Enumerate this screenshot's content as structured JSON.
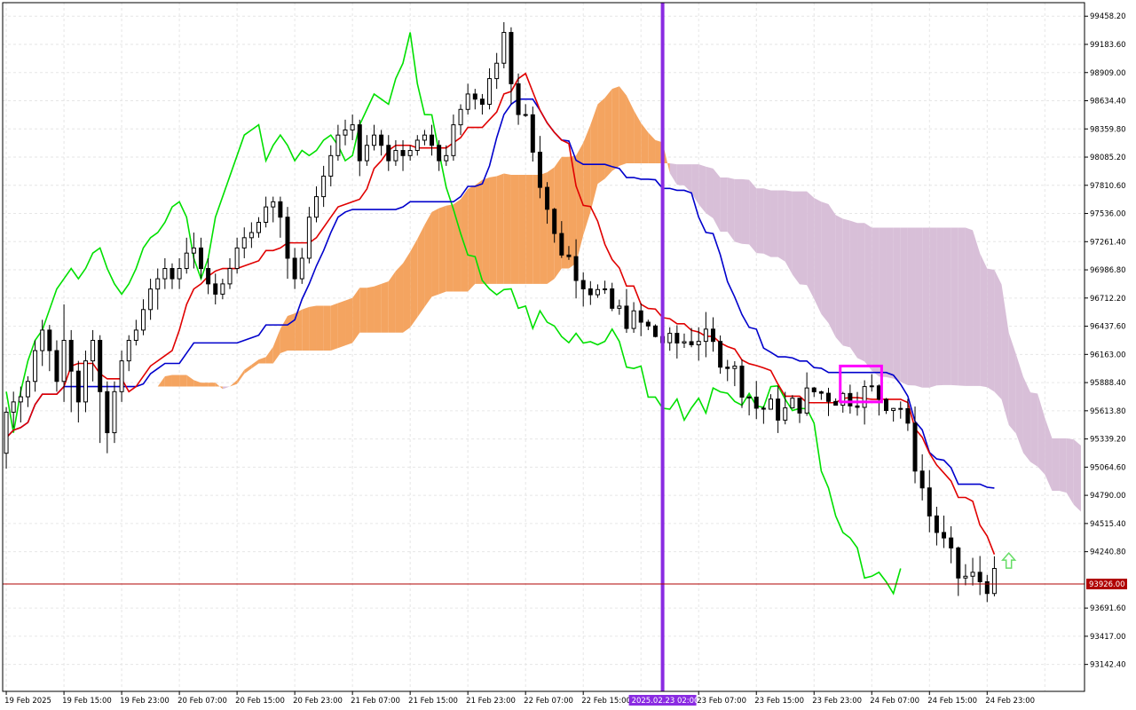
{
  "chart_data": {
    "type": "candlestick",
    "y_ticks": [
      "99458.20",
      "99183.60",
      "98909.00",
      "98634.40",
      "98359.80",
      "98085.20",
      "97810.60",
      "97536.00",
      "97261.40",
      "96986.80",
      "96712.20",
      "96437.60",
      "96163.00",
      "95888.40",
      "95613.80",
      "95339.20",
      "95064.60",
      "94790.00",
      "94515.40",
      "94240.80",
      "93691.60",
      "93417.00",
      "93142.40"
    ],
    "y_tick_values": [
      99458.2,
      99183.6,
      98909.0,
      98634.4,
      98359.8,
      98085.2,
      97810.6,
      97536.0,
      97261.4,
      96986.8,
      96712.2,
      96437.6,
      96163.0,
      95888.4,
      95613.8,
      95339.2,
      95064.6,
      94790.0,
      94515.4,
      94240.8,
      93691.6,
      93417.0,
      93142.4
    ],
    "ylim": [
      92880,
      99590
    ],
    "x_ticks": [
      "19 Feb 2025",
      "19 Feb 15:00",
      "19 Feb 23:00",
      "20 Feb 07:00",
      "20 Feb 15:00",
      "20 Feb 23:00",
      "21 Feb 07:00",
      "21 Feb 15:00",
      "21 Feb 23:00",
      "22 Feb 07:00",
      "22 Feb 15:00",
      "23 Feb 07:00",
      "23 Feb 15:00",
      "23 Feb 23:00",
      "24 Feb 07:00",
      "24 Feb 15:00",
      "24 Feb 23:00"
    ],
    "x_tick_index": [
      0,
      8,
      16,
      24,
      32,
      40,
      48,
      56,
      64,
      72,
      80,
      96,
      104,
      112,
      120,
      128,
      136
    ],
    "current_price": {
      "label": "93926.00",
      "value": 93926
    },
    "marker": {
      "label": "2025.02.23 02:00",
      "index": 91
    },
    "highlight_box": {
      "index_from": 116,
      "index_to": 121,
      "price_low": 95700,
      "price_high": 96050
    },
    "arrow_signal": {
      "index": 139,
      "price": 94150,
      "direction": "up"
    },
    "candles": [
      [
        95200,
        95600,
        95050,
        95650
      ],
      [
        95600,
        95700,
        95450,
        95800
      ],
      [
        95700,
        95750,
        95500,
        95850
      ],
      [
        95750,
        95900,
        95650,
        95950
      ],
      [
        95900,
        96200,
        95800,
        96300
      ],
      [
        96200,
        96400,
        96050,
        96500
      ],
      [
        96400,
        96200,
        96000,
        96450
      ],
      [
        96200,
        95900,
        95800,
        96300
      ],
      [
        95900,
        96300,
        95700,
        96650
      ],
      [
        96300,
        96000,
        95600,
        96400
      ],
      [
        96000,
        95700,
        95500,
        96100
      ],
      [
        95700,
        96100,
        95600,
        96200
      ],
      [
        96100,
        96300,
        95900,
        96400
      ],
      [
        96300,
        95800,
        95300,
        96350
      ],
      [
        95800,
        95400,
        95200,
        95900
      ],
      [
        95400,
        95800,
        95300,
        95900
      ],
      [
        95800,
        96100,
        95700,
        96200
      ],
      [
        96100,
        96300,
        96000,
        96350
      ],
      [
        96300,
        96400,
        96250,
        96500
      ],
      [
        96400,
        96600,
        96350,
        96700
      ],
      [
        96600,
        96800,
        96500,
        96900
      ],
      [
        96800,
        96900,
        96600,
        97000
      ],
      [
        96900,
        97000,
        96800,
        97100
      ],
      [
        97000,
        96900,
        96800,
        97050
      ],
      [
        96900,
        97000,
        96800,
        97100
      ],
      [
        97000,
        97150,
        96950,
        97300
      ],
      [
        97150,
        97200,
        97000,
        97350
      ],
      [
        97200,
        97000,
        96900,
        97300
      ],
      [
        97000,
        96850,
        96750,
        97100
      ],
      [
        96850,
        96750,
        96650,
        96950
      ],
      [
        96750,
        96850,
        96700,
        96900
      ],
      [
        96850,
        97000,
        96800,
        97100
      ],
      [
        97000,
        97200,
        96950,
        97300
      ],
      [
        97200,
        97300,
        97100,
        97400
      ],
      [
        97300,
        97350,
        97200,
        97450
      ],
      [
        97350,
        97450,
        97300,
        97500
      ],
      [
        97450,
        97600,
        97400,
        97700
      ],
      [
        97600,
        97650,
        97450,
        97700
      ],
      [
        97650,
        97500,
        97300,
        97700
      ],
      [
        97500,
        97100,
        96900,
        97600
      ],
      [
        97100,
        96900,
        96800,
        97200
      ],
      [
        96900,
        97100,
        96850,
        97200
      ],
      [
        97100,
        97500,
        97050,
        97600
      ],
      [
        97500,
        97700,
        97450,
        97800
      ],
      [
        97700,
        97900,
        97600,
        98000
      ],
      [
        97900,
        98100,
        97800,
        98200
      ],
      [
        98100,
        98300,
        98050,
        98400
      ],
      [
        98300,
        98350,
        98200,
        98450
      ],
      [
        98350,
        98400,
        98250,
        98500
      ],
      [
        98400,
        98050,
        97900,
        98450
      ],
      [
        98050,
        98200,
        98000,
        98300
      ],
      [
        98200,
        98300,
        98150,
        98400
      ],
      [
        98300,
        98200,
        98100,
        98350
      ],
      [
        98200,
        98050,
        97950,
        98300
      ],
      [
        98050,
        98150,
        98000,
        98250
      ],
      [
        98150,
        98100,
        97950,
        98250
      ],
      [
        98100,
        98150,
        98050,
        98200
      ],
      [
        98150,
        98250,
        98100,
        98300
      ],
      [
        98250,
        98300,
        98200,
        98350
      ],
      [
        98300,
        98200,
        98100,
        98400
      ],
      [
        98200,
        98050,
        97950,
        98250
      ],
      [
        98050,
        98100,
        98000,
        98200
      ],
      [
        98100,
        98400,
        98050,
        98500
      ],
      [
        98400,
        98550,
        98300,
        98600
      ],
      [
        98550,
        98700,
        98500,
        98800
      ],
      [
        98700,
        98650,
        98550,
        98750
      ],
      [
        98650,
        98600,
        98500,
        98700
      ],
      [
        98600,
        98850,
        98550,
        98950
      ],
      [
        98850,
        99000,
        98750,
        99100
      ],
      [
        99000,
        99300,
        98950,
        99400
      ],
      [
        99300,
        98800,
        98600,
        99350
      ],
      [
        98800,
        98500,
        98400,
        98900
      ]
    ],
    "tenkan": [],
    "kijun": [],
    "chikou": [],
    "cloud_top": [],
    "cloud_bottom": []
  },
  "colors": {
    "bull_candle": "#ffffff",
    "bear_candle": "#000000",
    "candle_outline": "#000000",
    "tenkan": "#e00000",
    "kijun": "#0000cc",
    "chikou": "#00e000",
    "cloud_bullish": "#f4a460",
    "cloud_bearish": "#d8bfd8",
    "marker_line": "#8a2be2",
    "current_price_line": "#b00000",
    "highlight_box": "#ff00ff",
    "grid": "#e6e6e6",
    "arrow": "#66dd66"
  }
}
